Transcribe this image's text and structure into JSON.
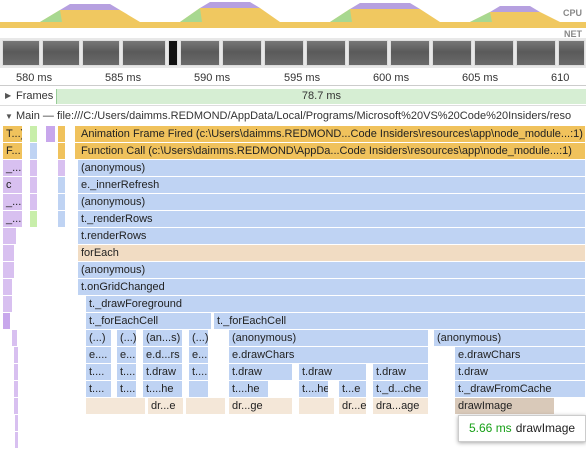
{
  "overview": {
    "cpu_label": "CPU",
    "net_label": "NET"
  },
  "ruler": {
    "ticks": [
      "580 ms",
      "585 ms",
      "590 ms",
      "595 ms",
      "600 ms",
      "605 ms",
      "610"
    ]
  },
  "frames": {
    "label": "Frames",
    "duration": "78.7 ms"
  },
  "main": {
    "label": "Main — file:///C:/Users/daimms.REDMOND/AppData/Local/Programs/Microsoft%20VS%20Code%20Insiders/reso"
  },
  "flame": {
    "row0": {
      "left": "T...)",
      "title": "Animation Frame Fired (c:\\Users\\daimms.REDMOND...Code Insiders\\resources\\app\\node_module...:1)"
    },
    "row1": {
      "left": "F...",
      "title": "Function Call (c:\\Users\\daimms.REDMOND\\AppDa...Code Insiders\\resources\\app\\node_module...:1)"
    },
    "row2": {
      "left": "_...",
      "title": "(anonymous)"
    },
    "row3": {
      "left": "c",
      "title": "e._innerRefresh"
    },
    "row4": {
      "left": "_...",
      "title": "(anonymous)"
    },
    "row5": {
      "left": "_...",
      "title": "t._renderRows"
    },
    "row6": {
      "title": "t.renderRows"
    },
    "row7": {
      "title": "forEach"
    },
    "row8": {
      "title": "(anonymous)"
    },
    "row9": {
      "title": "t.onGridChanged"
    },
    "row10": {
      "title": "t._drawForeground"
    },
    "row11": {
      "a": "t._forEachCell",
      "b": "t._forEachCell"
    },
    "row12": {
      "a": "(...)",
      "b": "(...)",
      "c": "(an...s)",
      "d": "(...)",
      "e": "(anonymous)",
      "f": "(anonymous)"
    },
    "row13": {
      "a": "e....",
      "b": "e....",
      "c": "e.d...rs",
      "d": "e....",
      "e": "e.drawChars",
      "f": "e.drawChars"
    },
    "row14": {
      "a": "t....",
      "b": "t....",
      "c": "t.draw",
      "d": "t....",
      "e": "t.draw",
      "f": "t.draw",
      "g": "t.draw",
      "h": "t.draw"
    },
    "row15": {
      "a": "t....",
      "b": "t....",
      "c": "t....he",
      "d": "t....he",
      "e": "t....he",
      "f": "t...e",
      "g": "t._d...che",
      "h": "t._drawFromCache"
    },
    "row16": {
      "a": "dr...e",
      "b": "dr...ge",
      "c": "dr...e",
      "d": "dra...age",
      "e": "drawImage"
    }
  },
  "tooltip": {
    "time": "5.66 ms",
    "name": "drawImage"
  }
}
